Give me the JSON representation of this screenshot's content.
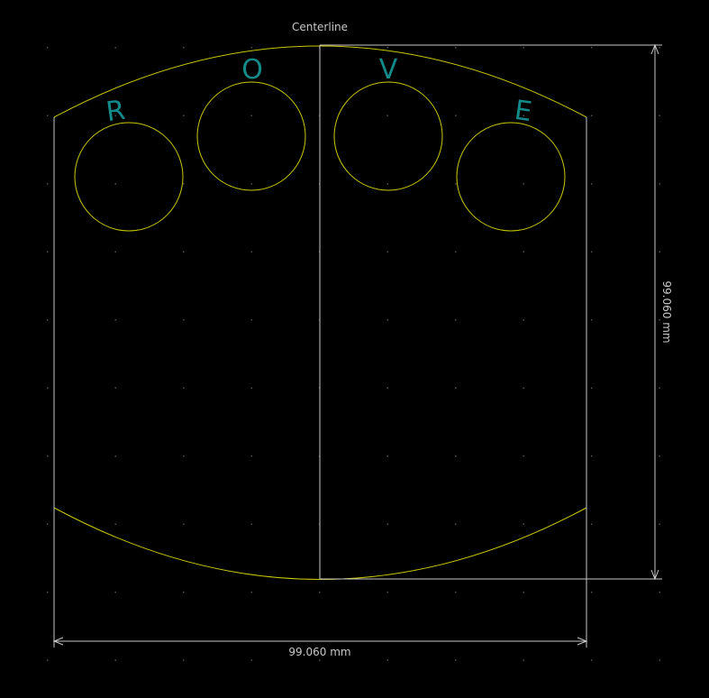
{
  "drawing": {
    "centerline_label": "Centerline",
    "width_dimension": "99.060 mm",
    "height_dimension": "99.060 mm",
    "hole_labels": [
      "R",
      "O",
      "V",
      "E"
    ]
  },
  "colors": {
    "background": "#000000",
    "outline": "#c8c800",
    "dimension": "#c8c8c8",
    "label": "#138a8a",
    "grid_dot": "#505050"
  }
}
